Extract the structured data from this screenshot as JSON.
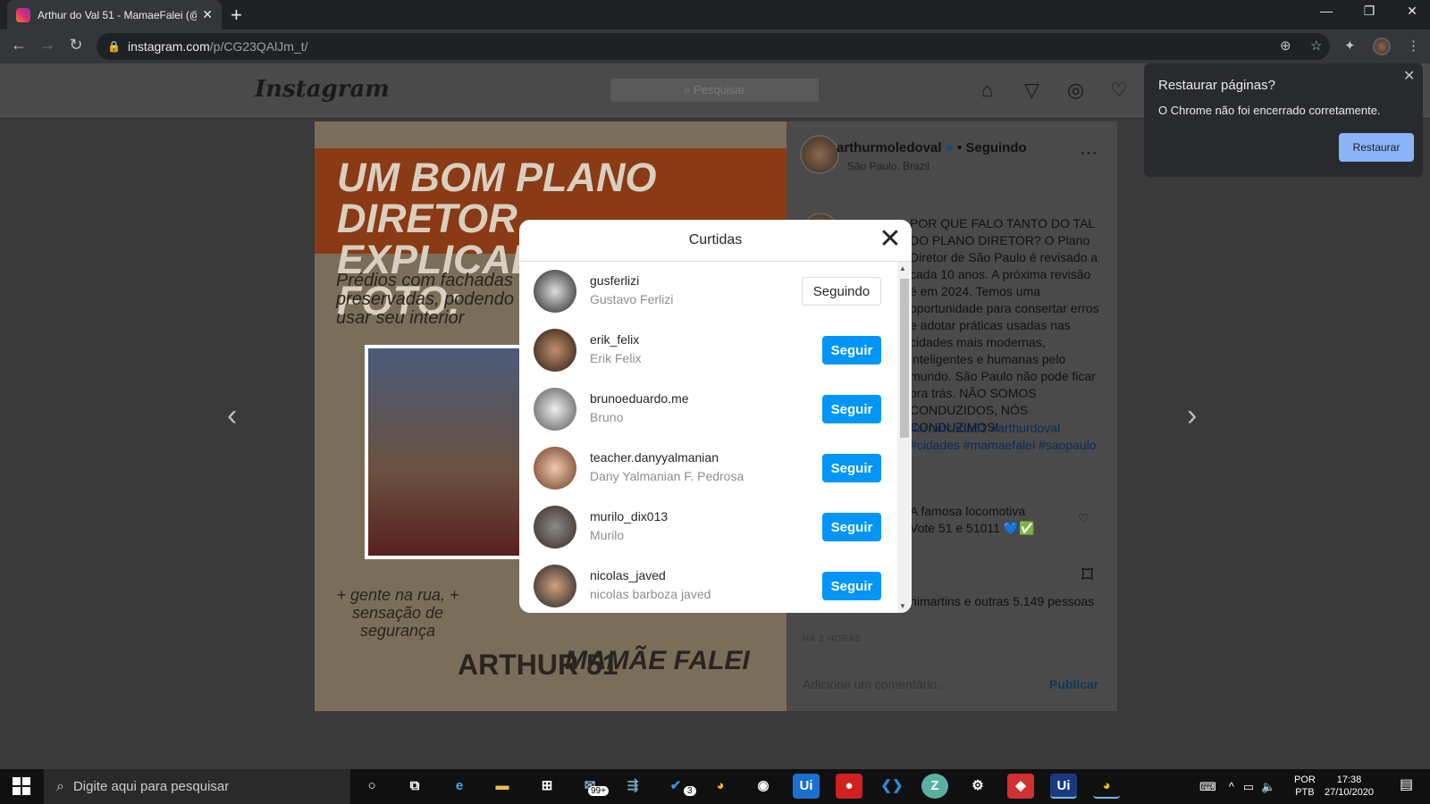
{
  "browser": {
    "tab_title": "Arthur do Val 51 - MamaeFalei (@",
    "url_host": "instagram.com",
    "url_path": "/p/CG23QAlJm_t/",
    "restore": {
      "title": "Restaurar páginas?",
      "message": "O Chrome não foi encerrado corretamente.",
      "button": "Restaurar"
    }
  },
  "instagram": {
    "logo": "Instagram",
    "search_placeholder": "Pesquisar",
    "post": {
      "author": "arthurmoledoval",
      "following_label": "• Seguindo",
      "location": "São Paulo, Brazil",
      "caption_author": "arthurmoledoval",
      "caption": "POR QUE FALO TANTO DO TAL DO PLANO DIRETOR? O Plano Diretor de São Paulo é revisado a cada 10 anos. A próxima revisão é em 2024. Temos uma oportunidade para consertar erros e adotar práticas usadas nas cidades mais modernas, inteligentes e humanas pelo mundo. São Paulo não pode ficar pra trás. NÃO SOMOS CONDUZIDOS, NÓS CONDUZIMOS!",
      "hashtags": "#arrancada51 #arthurdoval #cidades #mamaefalei #saopaulo",
      "comment": "A famosa locomotiva Vote 51 e 51011 💙✅",
      "likes": "Curtido por ovinimartins e outras 5.149 pessoas",
      "time": "HÁ 2 HORAS",
      "add_comment_placeholder": "Adicione um comentário...",
      "publish": "Publicar",
      "image": {
        "headline_line1": "UM BOM PLANO DIRETOR",
        "headline_line2": "EXPLICADO EM UMA FOTO:",
        "caption1": "Prédios com fachadas preservadas, podendo usar seu interior",
        "caption2": "+ gente na rua, + sensação de segurança",
        "brand1": "ARTHUR 51",
        "brand2": "MAMÃE FALEI"
      }
    }
  },
  "likes_modal": {
    "title": "Curtidas",
    "users": [
      {
        "username": "gusferlizi",
        "name": "Gustavo Ferlizi",
        "button": "Seguindo",
        "following": true
      },
      {
        "username": "erik_felix",
        "name": "Erik Felix",
        "button": "Seguir",
        "following": false
      },
      {
        "username": "brunoeduardo.me",
        "name": "Bruno",
        "button": "Seguir",
        "following": false
      },
      {
        "username": "teacher.danyyalmanian",
        "name": "Dany Yalmanian F. Pedrosa",
        "button": "Seguir",
        "following": false
      },
      {
        "username": "murilo_dix013",
        "name": "Murilo",
        "button": "Seguir",
        "following": false
      },
      {
        "username": "nicolas_javed",
        "name": "nicolas barboza javed",
        "button": "Seguir",
        "following": false
      }
    ]
  },
  "taskbar": {
    "search_placeholder": "Digite aqui para pesquisar",
    "mail_badge": "99+",
    "todo_badge": "3",
    "lang_line1": "POR",
    "lang_line2": "PTB",
    "time": "17:38",
    "date": "27/10/2020"
  },
  "colors": {
    "instagram_blue": "#0095f6",
    "chrome_restore": "#8ab4f8"
  }
}
